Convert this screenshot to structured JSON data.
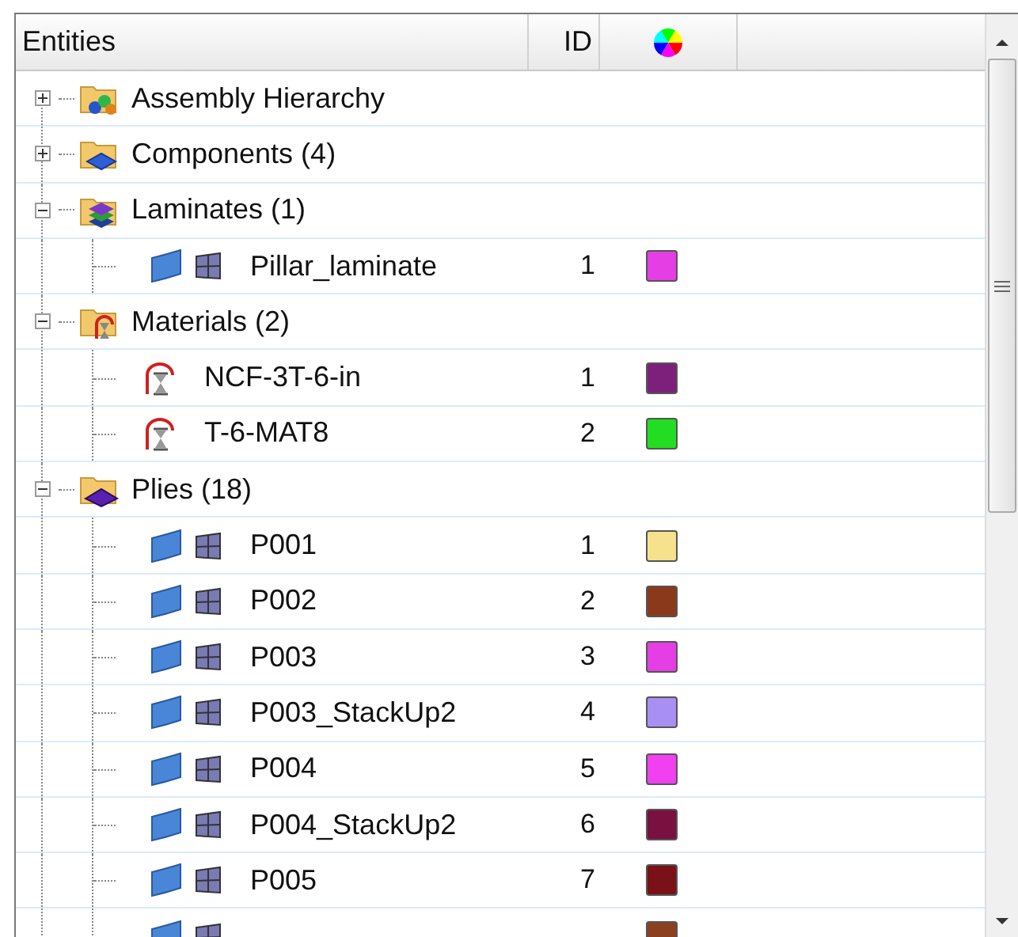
{
  "columns": [
    {
      "label": "Entities",
      "kind": "name"
    },
    {
      "label": "ID",
      "kind": "id"
    },
    {
      "kind": "color"
    }
  ],
  "tree": [
    {
      "label": "Assembly Hierarchy",
      "kind": "assembly",
      "expanded": false
    },
    {
      "label": "Components (4)",
      "kind": "components",
      "expanded": false
    },
    {
      "label": "Laminates (1)",
      "kind": "laminates",
      "expanded": true,
      "children": [
        {
          "label": "Pillar_laminate",
          "kind": "ply",
          "id": "1",
          "color": "#e43ee4"
        }
      ]
    },
    {
      "label": "Materials (2)",
      "kind": "materials",
      "expanded": true,
      "children": [
        {
          "label": "NCF-3T-6-in",
          "kind": "material",
          "id": "1",
          "color": "#7c207c"
        },
        {
          "label": "T-6-MAT8",
          "kind": "material",
          "id": "2",
          "color": "#22dd22"
        }
      ]
    },
    {
      "label": "Plies (18)",
      "kind": "plies",
      "expanded": true,
      "children": [
        {
          "label": "P001",
          "kind": "ply",
          "id": "1",
          "color": "#f6e28c"
        },
        {
          "label": "P002",
          "kind": "ply",
          "id": "2",
          "color": "#8a3a1a"
        },
        {
          "label": "P003",
          "kind": "ply",
          "id": "3",
          "color": "#e43ee4"
        },
        {
          "label": "P003_StackUp2",
          "kind": "ply",
          "id": "4",
          "color": "#a890f2"
        },
        {
          "label": "P004",
          "kind": "ply",
          "id": "5",
          "color": "#f040f0"
        },
        {
          "label": "P004_StackUp2",
          "kind": "ply",
          "id": "6",
          "color": "#7a1040"
        },
        {
          "label": "P005",
          "kind": "ply",
          "id": "7",
          "color": "#7a1018"
        },
        {
          "kind": "ply",
          "color": "#8b4020"
        }
      ]
    }
  ]
}
